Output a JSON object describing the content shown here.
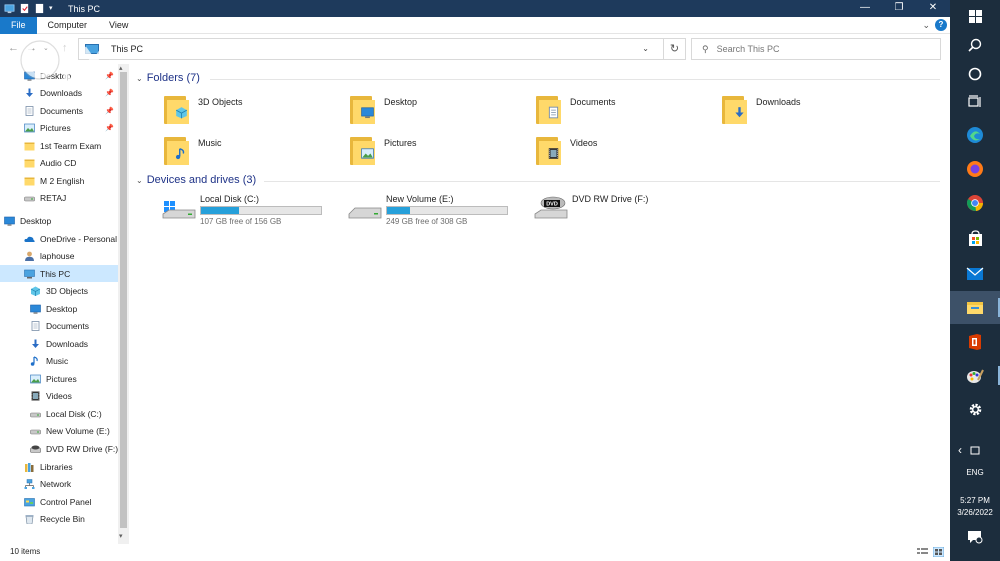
{
  "window": {
    "title": "This PC",
    "minimize_glyph": "—",
    "restore_glyph": "❐",
    "close_glyph": "✕"
  },
  "ribbon": {
    "tabs": [
      {
        "label": "File"
      },
      {
        "label": "Computer"
      },
      {
        "label": "View"
      }
    ],
    "expand_glyph": "⌄",
    "help_glyph": "?"
  },
  "navbar": {
    "up_glyph": "↑",
    "address": "This PC",
    "dropdown_glyph": "⌄",
    "refresh_glyph": "↻",
    "search_placeholder": "Search This PC",
    "search_glyph": "⚲"
  },
  "sidebar": {
    "items": [
      {
        "label": "Desktop",
        "icon": "desktop-icon",
        "pinned": true
      },
      {
        "label": "Downloads",
        "icon": "downloads-icon",
        "pinned": true
      },
      {
        "label": "Documents",
        "icon": "documents-icon",
        "pinned": true
      },
      {
        "label": "Pictures",
        "icon": "pictures-icon",
        "pinned": true
      },
      {
        "label": "1st Tearm Exam",
        "icon": "folder-icon"
      },
      {
        "label": "Audio CD",
        "icon": "folder-icon"
      },
      {
        "label": "M 2 English",
        "icon": "folder-icon"
      },
      {
        "label": "RETAJ",
        "icon": "drive-icon"
      },
      {
        "label": "Desktop",
        "icon": "desktop-icon"
      },
      {
        "label": "OneDrive - Personal",
        "icon": "onedrive-icon"
      },
      {
        "label": "laphouse",
        "icon": "user-icon"
      },
      {
        "label": "This PC",
        "icon": "this-pc-icon",
        "selected": true
      },
      {
        "label": "3D Objects",
        "icon": "3d-objects-icon"
      },
      {
        "label": "Desktop",
        "icon": "desktop-icon"
      },
      {
        "label": "Documents",
        "icon": "documents-icon"
      },
      {
        "label": "Downloads",
        "icon": "downloads-icon"
      },
      {
        "label": "Music",
        "icon": "music-icon"
      },
      {
        "label": "Pictures",
        "icon": "pictures-icon"
      },
      {
        "label": "Videos",
        "icon": "videos-icon"
      },
      {
        "label": "Local Disk (C:)",
        "icon": "drive-icon"
      },
      {
        "label": "New Volume (E:)",
        "icon": "drive-icon"
      },
      {
        "label": "DVD RW Drive (F:)",
        "icon": "dvd-icon"
      },
      {
        "label": "Libraries",
        "icon": "libraries-icon"
      },
      {
        "label": "Network",
        "icon": "network-icon"
      },
      {
        "label": "Control Panel",
        "icon": "control-panel-icon"
      },
      {
        "label": "Recycle Bin",
        "icon": "recycle-bin-icon"
      }
    ],
    "pin_glyph": "📌"
  },
  "content": {
    "folders_header": "Folders (7)",
    "folders": [
      {
        "label": "3D Objects",
        "badge": "3d-objects-icon"
      },
      {
        "label": "Desktop",
        "badge": "desktop-icon"
      },
      {
        "label": "Documents",
        "badge": "documents-icon"
      },
      {
        "label": "Downloads",
        "badge": "downloads-icon"
      },
      {
        "label": "Music",
        "badge": "music-icon"
      },
      {
        "label": "Pictures",
        "badge": "pictures-icon"
      },
      {
        "label": "Videos",
        "badge": "videos-icon"
      }
    ],
    "drives_header": "Devices and drives (3)",
    "drives": [
      {
        "name": "Local Disk (C:)",
        "free_text": "107 GB free of 156 GB",
        "used_fraction": 0.314,
        "icon": "windows-drive-icon"
      },
      {
        "name": "New Volume (E:)",
        "free_text": "249 GB free of 308 GB",
        "used_fraction": 0.192,
        "icon": "drive-icon"
      },
      {
        "name": "DVD RW Drive (F:)",
        "icon": "dvd-icon"
      }
    ],
    "dvd_label": "DVD"
  },
  "statusbar": {
    "item_count": "10 items"
  },
  "taskbar": {
    "language": "ENG",
    "time": "5:27 PM",
    "date": "3/26/2022",
    "chevron_glyph": "‹"
  },
  "colors": {
    "titlebar": "#1e3a5c",
    "accent": "#1979ca",
    "taskbar": "#1c2d3d",
    "drive_fill": "#26a0da",
    "selected_row": "#cce8ff",
    "group_header": "#1e3287"
  }
}
